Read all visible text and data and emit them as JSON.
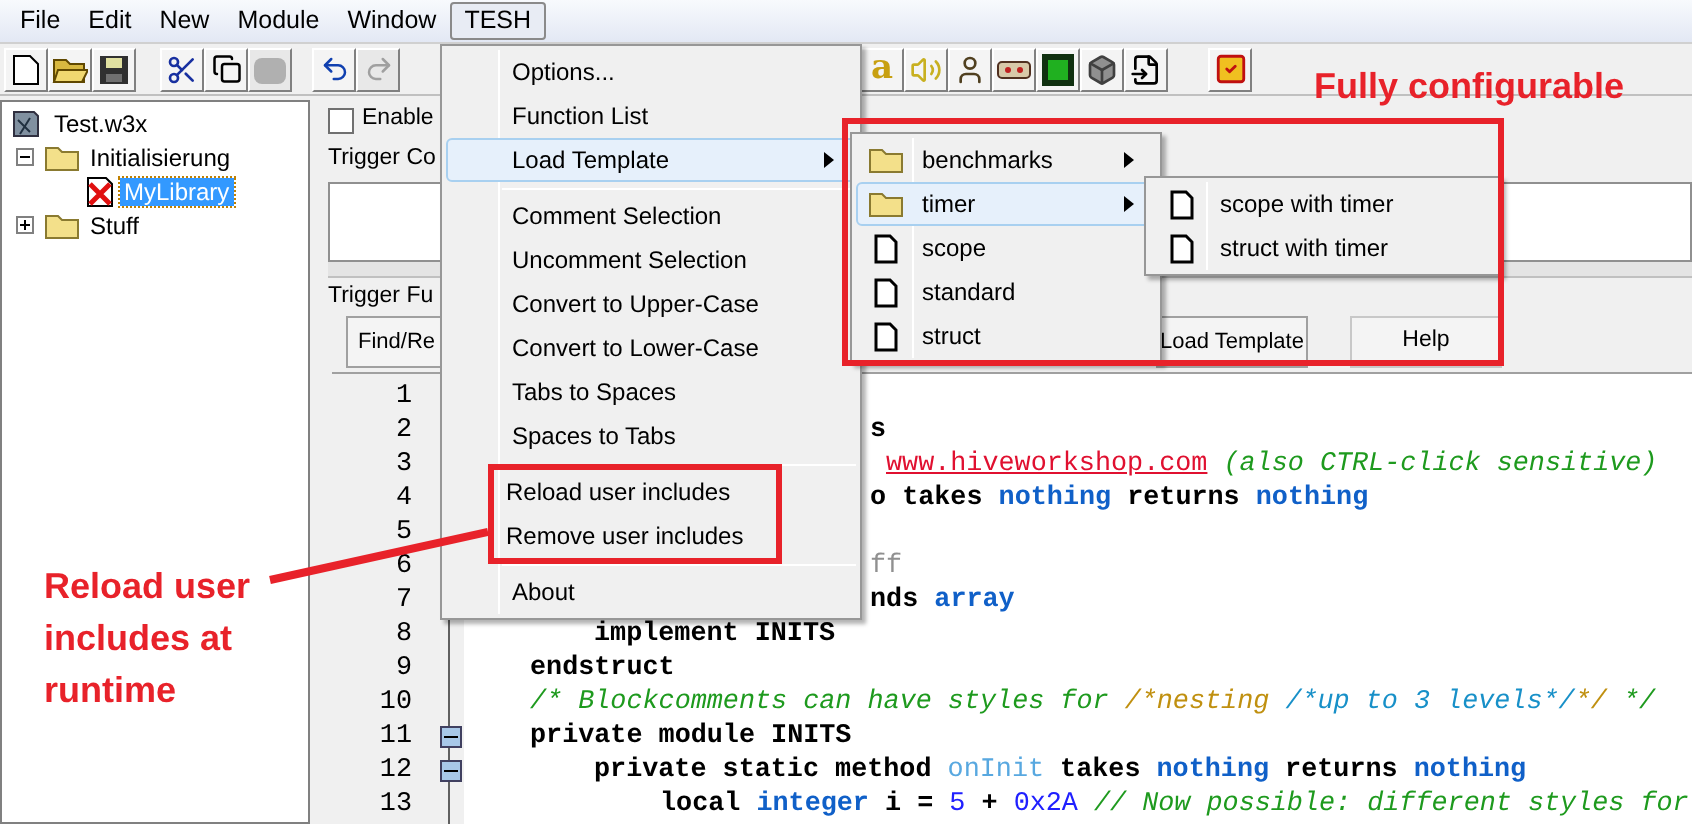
{
  "menu_bar": [
    {
      "label": "File",
      "selected": false
    },
    {
      "label": "Edit",
      "selected": false
    },
    {
      "label": "New",
      "selected": false
    },
    {
      "label": "Module",
      "selected": false
    },
    {
      "label": "Window",
      "selected": false
    },
    {
      "label": "TESH",
      "selected": true
    }
  ],
  "toolbar_groups": [
    [
      {
        "kind": "new",
        "disabled": false
      },
      {
        "kind": "open",
        "disabled": false
      },
      {
        "kind": "save",
        "disabled": false
      }
    ],
    [
      {
        "kind": "cut",
        "disabled": false
      },
      {
        "kind": "copy",
        "disabled": false
      },
      {
        "kind": "paste",
        "disabled": true
      }
    ],
    [
      {
        "kind": "undo",
        "disabled": false
      },
      {
        "kind": "redo",
        "disabled": true
      }
    ],
    [
      {
        "kind": "font",
        "glyph": "a",
        "disabled": false
      },
      {
        "kind": "sound",
        "disabled": false
      },
      {
        "kind": "figure",
        "disabled": false
      },
      {
        "kind": "panel",
        "disabled": false
      },
      {
        "kind": "monster",
        "disabled": false
      },
      {
        "kind": "cube",
        "disabled": false
      },
      {
        "kind": "import",
        "disabled": false
      }
    ],
    [
      {
        "kind": "checklist",
        "disabled": false
      }
    ]
  ],
  "tree": [
    {
      "label": "Test.w3x",
      "kind": "map",
      "selected": false,
      "children": [
        {
          "label": "Initialisierung",
          "kind": "folder",
          "expanded": true,
          "selected": false,
          "children": [
            {
              "label": "MyLibrary",
              "kind": "trigger",
              "selected": true
            }
          ]
        },
        {
          "label": "Stuff",
          "kind": "folder",
          "expanded": false,
          "selected": false
        }
      ]
    }
  ],
  "trigger": {
    "enabled_label": "Enable",
    "enabled": false,
    "comment_label": "Trigger Co",
    "functions_label": "Trigger Fu"
  },
  "editor_buttons": [
    {
      "label": "Find/Re"
    },
    {
      "label": "Load Template"
    },
    {
      "label": "Help"
    }
  ],
  "code_lines": [
    {
      "number": "1",
      "fold": false
    },
    {
      "number": "2",
      "fold": false,
      "segments": [
        {
          "kind": "keyword",
          "text": "s"
        }
      ]
    },
    {
      "number": "3",
      "fold": false,
      "segments": [
        {
          "kind": "link",
          "text": "www.hiveworkshop.com"
        },
        {
          "kind": "comment",
          "text": " (also CTRL-click sensitive)"
        }
      ]
    },
    {
      "number": "4",
      "fold": false,
      "segments": [
        {
          "kind": "keyword",
          "text": "o takes "
        },
        {
          "kind": "type",
          "text": "nothing"
        },
        {
          "kind": "keyword",
          "text": " returns "
        },
        {
          "kind": "type",
          "text": "nothing"
        }
      ]
    },
    {
      "number": "5",
      "fold": false
    },
    {
      "number": "6",
      "fold": false,
      "segments": [
        {
          "kind": "dim",
          "text": "ff"
        }
      ]
    },
    {
      "number": "7",
      "fold": false,
      "segments": [
        {
          "kind": "keyword",
          "text": "nds "
        },
        {
          "kind": "type",
          "text": "array"
        }
      ]
    },
    {
      "number": "8",
      "fold": false,
      "segments": [
        {
          "kind": "keyword",
          "text": "implement INITS"
        }
      ]
    },
    {
      "number": "9",
      "fold": false,
      "segments": [
        {
          "kind": "keyword",
          "text": "endstruct"
        }
      ]
    },
    {
      "number": "10",
      "fold": false,
      "segments": [
        {
          "kind": "comment",
          "text": "/* Blockcomments can have styles for "
        },
        {
          "kind": "nest2",
          "text": "/*nesting "
        },
        {
          "kind": "nest3",
          "text": "/*up to 3 levels*/"
        },
        {
          "kind": "nest2",
          "text": "*/"
        },
        {
          "kind": "comment",
          "text": " */"
        }
      ]
    },
    {
      "number": "11",
      "fold": true,
      "segments": [
        {
          "kind": "keyword",
          "text": "private module INITS"
        }
      ]
    },
    {
      "number": "12",
      "fold": true,
      "segments": [
        {
          "kind": "keyword",
          "text": "private static method "
        },
        {
          "kind": "function",
          "text": "onInit"
        },
        {
          "kind": "keyword",
          "text": " takes "
        },
        {
          "kind": "type",
          "text": "nothing"
        },
        {
          "kind": "keyword",
          "text": " returns "
        },
        {
          "kind": "type",
          "text": "nothing"
        }
      ]
    },
    {
      "number": "13",
      "fold": false,
      "segments": [
        {
          "kind": "keyword",
          "text": "local "
        },
        {
          "kind": "type",
          "text": "integer"
        },
        {
          "kind": "keyword",
          "text": " i = "
        },
        {
          "kind": "number",
          "text": "5"
        },
        {
          "kind": "keyword",
          "text": " + "
        },
        {
          "kind": "number",
          "text": "0x2A"
        },
        {
          "kind": "comment",
          "text": " // Now possible: different styles for"
        }
      ]
    }
  ],
  "tesh_menu": [
    {
      "kind": "item",
      "label": "Options...",
      "selected": false
    },
    {
      "kind": "item",
      "label": "Function List",
      "selected": false
    },
    {
      "kind": "submenu",
      "label": "Load Template",
      "selected": true
    },
    {
      "kind": "separator"
    },
    {
      "kind": "item",
      "label": "Comment Selection",
      "selected": false
    },
    {
      "kind": "item",
      "label": "Uncomment Selection",
      "selected": false
    },
    {
      "kind": "item",
      "label": "Convert to Upper-Case",
      "selected": false
    },
    {
      "kind": "item",
      "label": "Convert to Lower-Case",
      "selected": false
    },
    {
      "kind": "item",
      "label": "Tabs to Spaces",
      "selected": false
    },
    {
      "kind": "item",
      "label": "Spaces to Tabs",
      "selected": false
    },
    {
      "kind": "separator"
    },
    {
      "kind": "item",
      "label": "Reload user includes",
      "selected": false
    },
    {
      "kind": "item",
      "label": "Remove user includes",
      "selected": false
    },
    {
      "kind": "separator"
    },
    {
      "kind": "item",
      "label": "About",
      "selected": false
    }
  ],
  "template_menu": [
    {
      "kind": "folder",
      "label": "benchmarks",
      "selected": false
    },
    {
      "kind": "folder",
      "label": "timer",
      "selected": true
    },
    {
      "kind": "file",
      "label": "scope",
      "selected": false
    },
    {
      "kind": "file",
      "label": "standard",
      "selected": false
    },
    {
      "kind": "file",
      "label": "struct",
      "selected": false
    }
  ],
  "timer_menu": [
    {
      "kind": "file",
      "label": "scope with timer",
      "selected": false
    },
    {
      "kind": "file",
      "label": "struct with timer",
      "selected": false
    }
  ],
  "annotations": [
    {
      "text": "Fully configurable"
    },
    {
      "text": "Reload user includes at runtime"
    }
  ]
}
